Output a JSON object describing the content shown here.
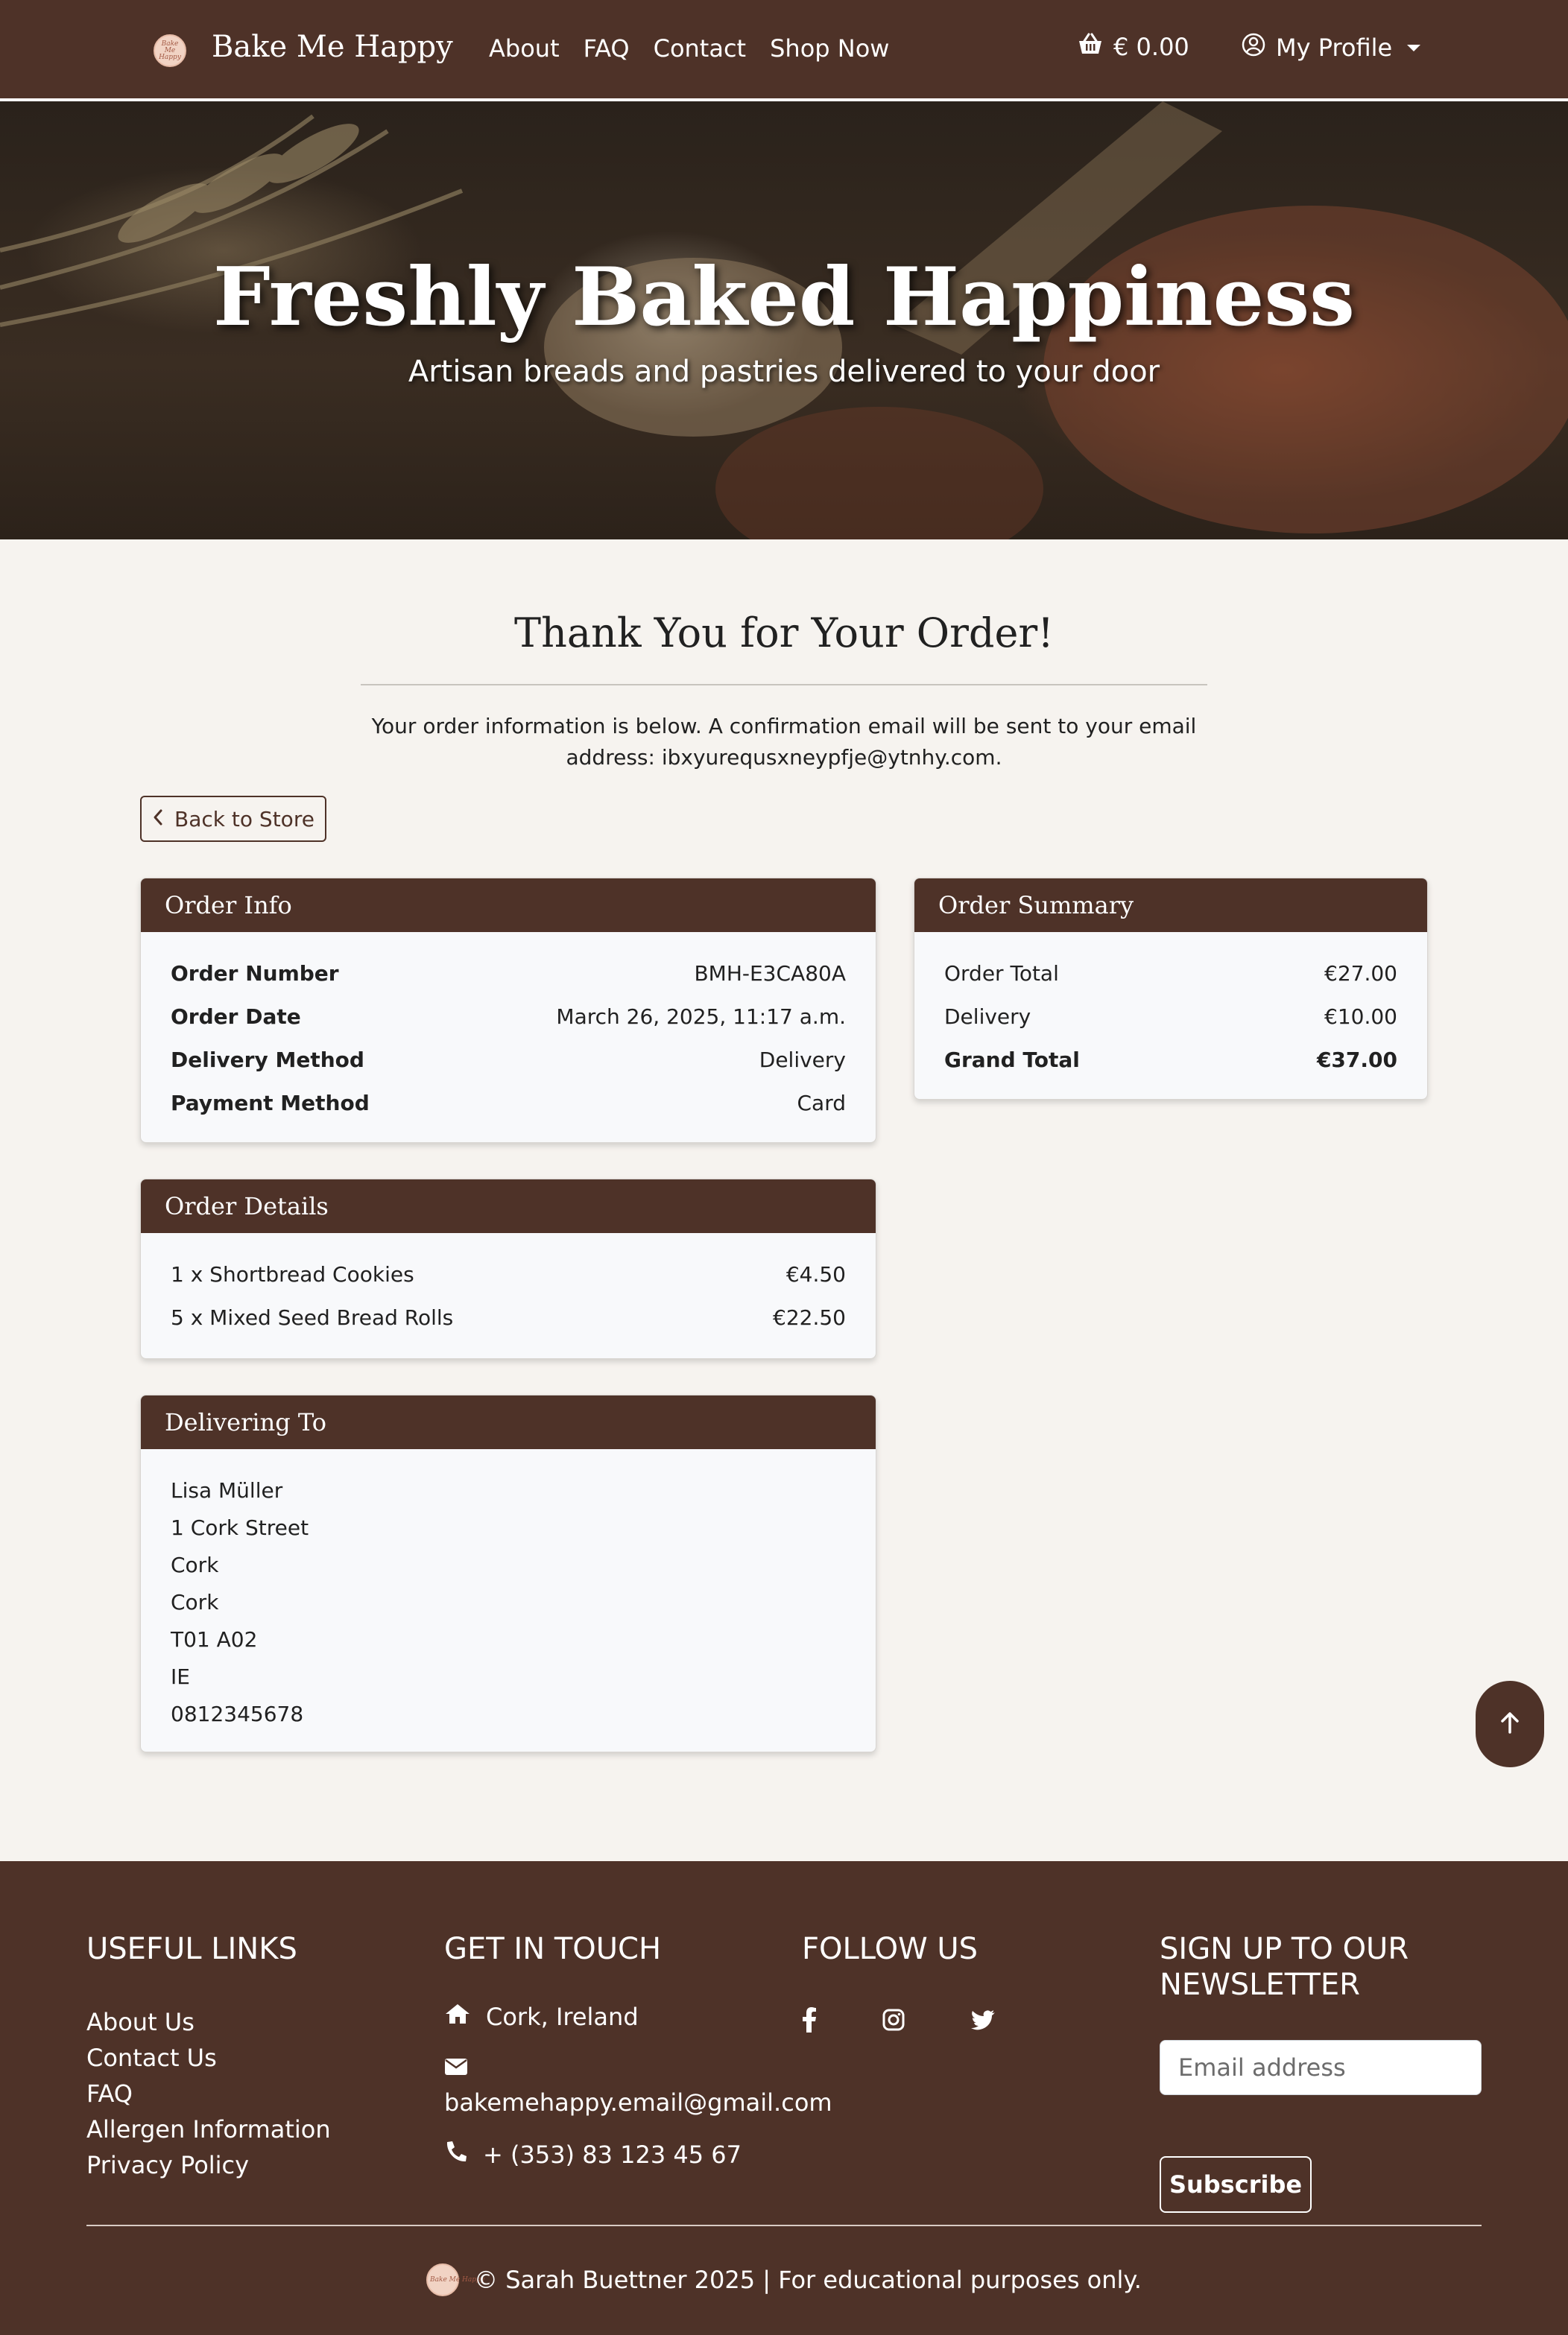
{
  "nav": {
    "brand": "Bake Me Happy",
    "logo_text": "Bake Me Happy",
    "links": [
      "About",
      "FAQ",
      "Contact",
      "Shop Now"
    ],
    "cart_total": "€ 0.00",
    "profile_label": "My Profile"
  },
  "hero": {
    "title": "Freshly Baked Happiness",
    "subtitle": "Artisan breads and pastries delivered to your door"
  },
  "main": {
    "title": "Thank You for Your Order!",
    "intro": "Your order information is below. A confirmation email will be sent to your email address: ibxyurequsxneypfje@ytnhy.com.",
    "back_label": "Back to Store"
  },
  "order_info": {
    "header": "Order Info",
    "rows": [
      {
        "label": "Order Number",
        "value": "BMH-E3CA80A"
      },
      {
        "label": "Order Date",
        "value": "March 26, 2025, 11:17 a.m."
      },
      {
        "label": "Delivery Method",
        "value": "Delivery"
      },
      {
        "label": "Payment Method",
        "value": "Card"
      }
    ]
  },
  "order_summary": {
    "header": "Order Summary",
    "rows": [
      {
        "label": "Order Total",
        "value": "€27.00"
      },
      {
        "label": "Delivery",
        "value": "€10.00"
      },
      {
        "label": "Grand Total",
        "value": "€37.00"
      }
    ]
  },
  "order_details": {
    "header": "Order Details",
    "items": [
      {
        "label": "1 x Shortbread Cookies",
        "value": "€4.50"
      },
      {
        "label": "5 x Mixed Seed Bread Rolls",
        "value": "€22.50"
      }
    ]
  },
  "delivering_to": {
    "header": "Delivering To",
    "lines": [
      "Lisa Müller",
      "1 Cork Street",
      "Cork",
      "Cork",
      "T01 A02",
      "IE",
      "0812345678"
    ]
  },
  "footer": {
    "useful_links_heading": "USEFUL LINKS",
    "useful_links": [
      "About Us",
      "Contact Us",
      "FAQ",
      "Allergen Information",
      "Privacy Policy"
    ],
    "contact_heading": "GET IN TOUCH",
    "location": "Cork, Ireland",
    "email": "bakemehappy.email@gmail.com",
    "phone": "+ (353) 83 123 45 67",
    "follow_heading": "FOLLOW US",
    "social_icons": [
      "facebook-icon",
      "instagram-icon",
      "twitter-icon"
    ],
    "newsletter_heading_line1": "SIGN UP TO OUR",
    "newsletter_heading_line2": "NEWSLETTER",
    "email_placeholder": "Email address",
    "subscribe_label": "Subscribe",
    "copyright": "© Sarah Buettner 2025 | For educational purposes only."
  },
  "colors": {
    "brand_brown": "#4e3228",
    "page_background": "#f6f3ef",
    "card_background": "#f8f9fb"
  }
}
